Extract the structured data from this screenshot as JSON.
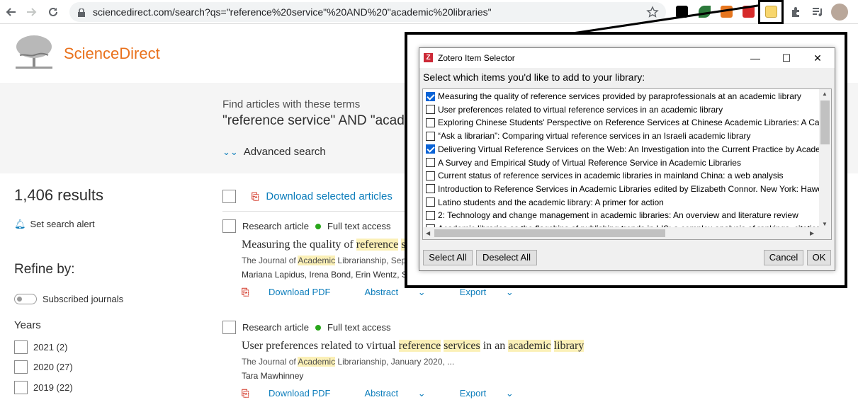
{
  "browser": {
    "url": "sciencedirect.com/search?qs=\"reference%20service\"%20AND%20\"academic%20libraries\""
  },
  "site": {
    "name": "ScienceDirect",
    "brand_color": "#e9711c",
    "link_color": "#0c7dbb"
  },
  "search": {
    "label": "Find articles with these terms",
    "terms": "\"reference service\" AND \"academic",
    "advanced": "Advanced search"
  },
  "results": {
    "count": "1,406 results",
    "set_alert": "Set search alert",
    "download_selected": "Download selected articles"
  },
  "refine": {
    "title": "Refine by:",
    "subscribed": "Subscribed journals",
    "years_label": "Years",
    "years": [
      "2021 (2)",
      "2020 (27)",
      "2019 (22)"
    ]
  },
  "articles": [
    {
      "type": "Research article",
      "access": "Full text access",
      "title_plain_1": "Measuring the quality of ",
      "title_hl_1": "reference",
      "title_hl_2": "s",
      "journal_pre": "The Journal of ",
      "journal_hl": "Academic",
      "journal_post": " Librarianship, Septe",
      "authors": "Mariana Lapidus, Irena Bond, Erin Wentz, Samuel Bishop King, Susan S. Mahnken",
      "download": "Download PDF",
      "abstract": "Abstract",
      "export": "Export"
    },
    {
      "type": "Research article",
      "access": "Full text access",
      "title_plain_1": "User preferences related to virtual ",
      "title_hl_1": "reference",
      "title_hl_2": "services",
      "title_plain_2": " in an ",
      "title_hl_3": "academic",
      "title_hl_4": "library",
      "journal_pre": "The Journal of ",
      "journal_hl": "Academic",
      "journal_post": " Librarianship, January 2020, ...",
      "authors": "Tara Mawhinney",
      "download": "Download PDF",
      "abstract": "Abstract",
      "export": "Export"
    }
  ],
  "zotero": {
    "title": "Zotero Item Selector",
    "prompt": "Select which items you'd like to add to your library:",
    "items": [
      {
        "text": "Measuring the quality of reference services provided by paraprofessionals at an academic library",
        "checked": true
      },
      {
        "text": "User preferences related to virtual reference services in an academic library",
        "checked": false
      },
      {
        "text": "Exploring Chinese Students' Perspective on Reference Services at Chinese Academic Libraries: A Cas",
        "checked": false
      },
      {
        "text": "“Ask a librarian”: Comparing virtual reference services in an Israeli academic library",
        "checked": false
      },
      {
        "text": "Delivering Virtual Reference Services on the Web: An Investigation into the Current Practice by Acade",
        "checked": true
      },
      {
        "text": "A Survey and Empirical Study of Virtual Reference Service in Academic Libraries",
        "checked": false
      },
      {
        "text": "Current status of reference services in academic libraries in mainland China: a web analysis",
        "checked": false
      },
      {
        "text": "Introduction to Reference Services in Academic Libraries edited by Elizabeth Connor. New York: Hawo",
        "checked": false
      },
      {
        "text": "Latino students and the academic library: A primer for action",
        "checked": false
      },
      {
        "text": "2: Technology and change management in academic libraries: An overview and literature review",
        "checked": false
      },
      {
        "text": "Academic libraries as the flagships of publishing trends in LIS: a complex analysis of rankings, citation",
        "checked": false
      }
    ],
    "select_all": "Select All",
    "deselect_all": "Deselect All",
    "cancel": "Cancel",
    "ok": "OK"
  }
}
